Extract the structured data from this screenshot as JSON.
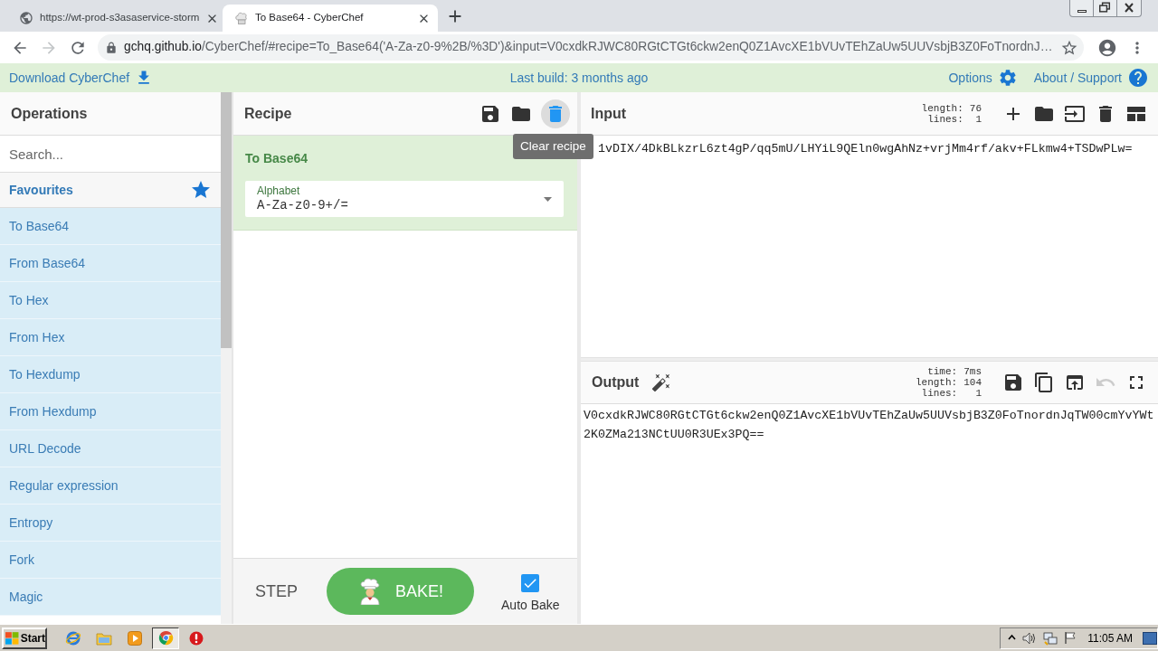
{
  "browser": {
    "tabs": [
      {
        "title": "https://wt-prod-s3asaservice-storm",
        "selected": false,
        "kind": "globe"
      },
      {
        "title": "To Base64 - CyberChef",
        "selected": true,
        "kind": "chef"
      }
    ],
    "forward_disabled": true,
    "address": {
      "host": "gchq.github.io",
      "path": "/CyberChef/#recipe=To_Base64('A-Za-z0-9%2B/%3D')&input=V0cxdkRJWC80RGtCTGt6ckw2enQ0Z1AvcXE1bVUvTEhZaUw5UUVsbjB3Z0FoTnordnJ…"
    }
  },
  "banner": {
    "download": "Download CyberChef",
    "build": "Last build: 3 months ago",
    "options": "Options",
    "about": "About / Support"
  },
  "operations": {
    "title": "Operations",
    "search_placeholder": "Search...",
    "favourites": "Favourites",
    "items": [
      "To Base64",
      "From Base64",
      "To Hex",
      "From Hex",
      "To Hexdump",
      "From Hexdump",
      "URL Decode",
      "Regular expression",
      "Entropy",
      "Fork",
      "Magic"
    ]
  },
  "recipe": {
    "title": "Recipe",
    "buttons": [
      {
        "kind": "save",
        "active": false
      },
      {
        "kind": "load",
        "active": false
      },
      {
        "kind": "clear",
        "active": true
      }
    ],
    "tooltip": "Clear recipe",
    "operation": {
      "name": "To Base64",
      "fields": [
        {
          "label": "Alphabet",
          "value": "A-Za-z0-9+/="
        }
      ]
    },
    "step": "STEP",
    "bake": "BAKE!",
    "auto_bake": {
      "label": "Auto Bake",
      "checked": true
    }
  },
  "input": {
    "title": "Input",
    "stats": [
      {
        "label": "length:",
        "value": "76"
      },
      {
        "label": "lines:",
        "value": "1"
      }
    ],
    "buttons": [
      {
        "kind": "add"
      },
      {
        "kind": "load"
      },
      {
        "kind": "open"
      },
      {
        "kind": "clear"
      },
      {
        "kind": "layout"
      }
    ],
    "text": "1vDIX/4DkBLkzrL6zt4gP/qq5mU/LHYiL9QEln0wgAhNz+vrjMm4rf/akv+FLkmw4+TSDwPLw="
  },
  "output": {
    "title": "Output",
    "stats": [
      {
        "label": "time:",
        "value": "7ms"
      },
      {
        "label": "length:",
        "value": "104"
      },
      {
        "label": "lines:",
        "value": "1"
      }
    ],
    "buttons": [
      {
        "kind": "save",
        "disabled": false
      },
      {
        "kind": "copy",
        "disabled": false
      },
      {
        "kind": "replace",
        "disabled": false
      },
      {
        "kind": "undo",
        "disabled": true
      },
      {
        "kind": "maximise",
        "disabled": false
      }
    ],
    "text": "V0cxdkRJWC80RGtCTGt6ckw2enQ0Z1AvcXE1bVUvTEhZaUw5UUVsbjB3Z0FoTnordnJqTW00cmYvYWt2K0ZMa213NCtUU0R3UEx3PQ=="
  },
  "taskbar": {
    "start": "Start",
    "apps": [
      {
        "kind": "ie",
        "selected": false
      },
      {
        "kind": "explorer",
        "selected": false
      },
      {
        "kind": "media",
        "selected": false
      },
      {
        "kind": "chrome",
        "selected": true
      },
      {
        "kind": "alert",
        "selected": false
      }
    ],
    "clock": "11:05 AM"
  }
}
